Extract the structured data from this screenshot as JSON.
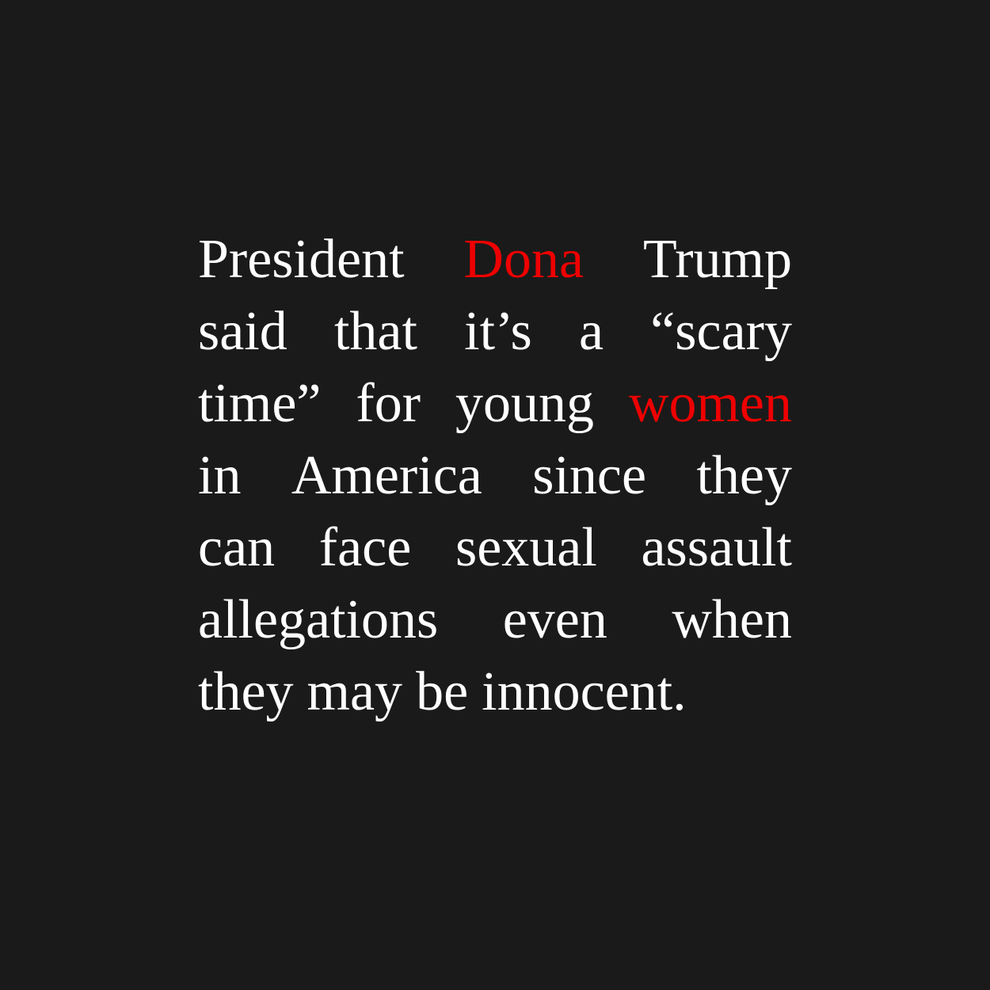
{
  "colors": {
    "background": "#1a1a1a",
    "text": "#ffffff",
    "highlight": "#ee0000"
  },
  "lines": [
    [
      {
        "text": "President",
        "highlight": false
      },
      {
        "text": "Dona",
        "highlight": true
      },
      {
        "text": "Trump",
        "highlight": false
      }
    ],
    [
      {
        "text": "said",
        "highlight": false
      },
      {
        "text": "that",
        "highlight": false
      },
      {
        "text": "it’s",
        "highlight": false
      },
      {
        "text": "a",
        "highlight": false
      },
      {
        "text": "“scary",
        "highlight": false
      }
    ],
    [
      {
        "text": "time”",
        "highlight": false
      },
      {
        "text": "for",
        "highlight": false
      },
      {
        "text": "young",
        "highlight": false
      },
      {
        "text": "women",
        "highlight": true
      }
    ],
    [
      {
        "text": "in",
        "highlight": false
      },
      {
        "text": "America",
        "highlight": false
      },
      {
        "text": "since",
        "highlight": false
      },
      {
        "text": "they",
        "highlight": false
      }
    ],
    [
      {
        "text": "can",
        "highlight": false
      },
      {
        "text": "face",
        "highlight": false
      },
      {
        "text": "sexual",
        "highlight": false
      },
      {
        "text": "assault",
        "highlight": false
      }
    ],
    [
      {
        "text": "allegations",
        "highlight": false
      },
      {
        "text": "even",
        "highlight": false
      },
      {
        "text": "when",
        "highlight": false
      }
    ],
    [
      {
        "text": "they",
        "highlight": false
      },
      {
        "text": "may",
        "highlight": false
      },
      {
        "text": "be",
        "highlight": false
      },
      {
        "text": "innocent.",
        "highlight": false
      }
    ]
  ]
}
